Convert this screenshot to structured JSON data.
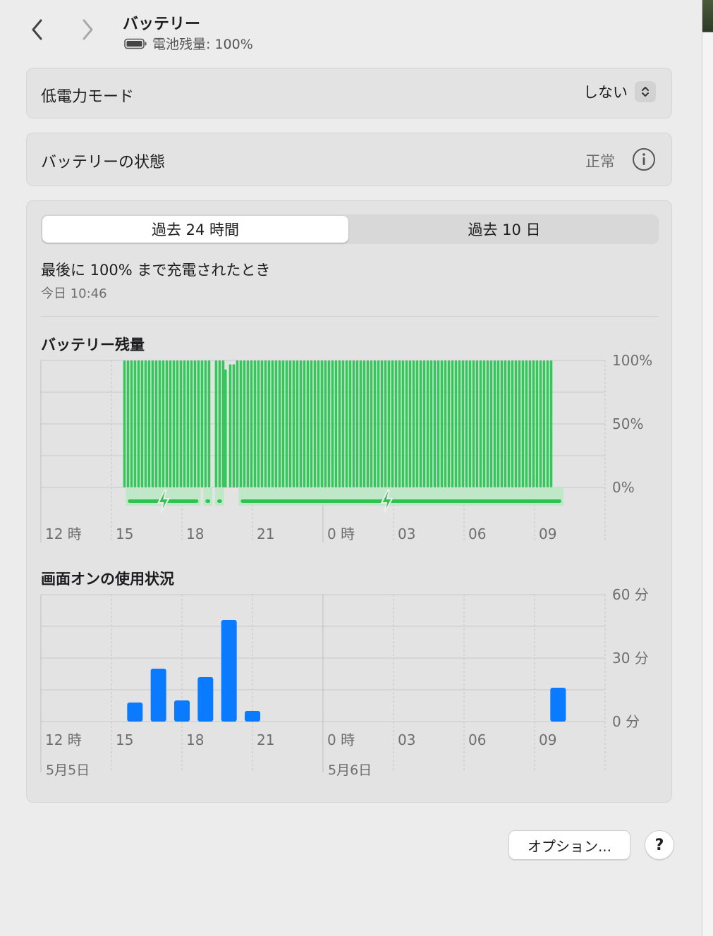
{
  "header": {
    "title": "バッテリー",
    "battery_level_text": "電池残量: 100%"
  },
  "low_power": {
    "label": "低電力モード",
    "value": "しない"
  },
  "battery_health": {
    "label": "バッテリーの状態",
    "value": "正常"
  },
  "tabs": [
    {
      "label": "過去 24 時間",
      "selected": true
    },
    {
      "label": "過去 10 日",
      "selected": false
    }
  ],
  "last_charged": {
    "label": "最後に 100% まで充電されたとき",
    "time": "今日 10:46"
  },
  "x_ticks": [
    "12 時",
    "15",
    "18",
    "21",
    "0 時",
    "03",
    "06",
    "09"
  ],
  "date_labels": [
    "5月5日",
    "5月6日"
  ],
  "footer": {
    "options_label": "オプション...",
    "help_label": "?"
  },
  "colors": {
    "battery_green": "#34c759",
    "usage_blue": "#0a7aff"
  },
  "chart_data": [
    {
      "type": "bar",
      "title": "バッテリー残量",
      "y_ticks": [
        "100%",
        "50%",
        "0%"
      ],
      "ylim": [
        0,
        100
      ],
      "unit": "%",
      "x_range_hours": [
        12,
        36
      ],
      "segments": [
        {
          "start": 15.5,
          "end": 19.3,
          "value": 100
        },
        {
          "start": 19.4,
          "end": 19.8,
          "value": 100
        },
        {
          "start": 19.8,
          "end": 20.0,
          "value": 93
        },
        {
          "start": 20.0,
          "end": 20.3,
          "value": 97
        },
        {
          "start": 20.3,
          "end": 33.8,
          "value": 100
        }
      ],
      "charging": [
        {
          "start": 15.7,
          "end": 18.7
        },
        {
          "start": 19.0,
          "end": 19.2
        },
        {
          "start": 19.5,
          "end": 19.7
        },
        {
          "start": 20.5,
          "end": 38.6
        }
      ],
      "charging_icons": [
        17.2,
        26.7
      ]
    },
    {
      "type": "bar",
      "title": "画面オンの使用状況",
      "y_ticks": [
        "60 分",
        "30 分",
        "0 分"
      ],
      "ylim": [
        0,
        60
      ],
      "unit": "分",
      "x_range_hours": [
        12,
        36
      ],
      "bars": [
        {
          "hour": 16,
          "value": 9
        },
        {
          "hour": 17,
          "value": 25
        },
        {
          "hour": 18,
          "value": 10
        },
        {
          "hour": 19,
          "value": 21
        },
        {
          "hour": 20,
          "value": 48
        },
        {
          "hour": 21,
          "value": 5
        },
        {
          "hour": 34,
          "value": 16
        }
      ]
    }
  ]
}
